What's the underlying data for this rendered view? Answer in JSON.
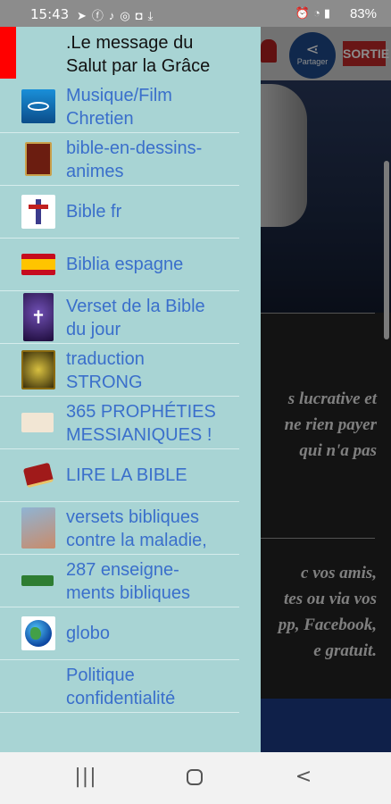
{
  "status_bar": {
    "time": "15:43",
    "left_icons": [
      "telegram-icon",
      "facebook-icon",
      "bell-icon",
      "notification-icon",
      "instagram-icon",
      "download-icon"
    ],
    "right_icons": [
      "alarm-icon",
      "wifi-icon",
      "signal-icon"
    ],
    "battery": "83%"
  },
  "drawer": {
    "header_title_line1": ".Le message du",
    "header_title_line2": "Salut par la Grâce",
    "accent_color": "#ff0000",
    "background": "#a8d4d4",
    "link_color": "#3a6fcb",
    "items": [
      {
        "line1": "Musique/Film",
        "line2": "Chretien",
        "icon": "fish-icon"
      },
      {
        "line1": "bible-en-dessins-",
        "line2": "animes",
        "icon": "book-icon"
      },
      {
        "line1": "Bible fr",
        "line2": "",
        "icon": "cross-icon"
      },
      {
        "line1": "Biblia espagne",
        "line2": "",
        "icon": "spain-flag-icon"
      },
      {
        "line1": "Verset de la Bible",
        "line2": "du jour",
        "icon": "verse-icon"
      },
      {
        "line1": "traduction",
        "line2": "STRONG",
        "icon": "strong-icon"
      },
      {
        "line1": "365 PROPHÉTIES",
        "line2": "MESSIANIQUES !",
        "icon": "prophecy-icon"
      },
      {
        "line1": "LIRE LA BIBLE",
        "line2": "",
        "icon": "bible-icon"
      },
      {
        "line1": " versets bibliques",
        "line2": "contre la maladie,",
        "icon": "hand-icon"
      },
      {
        "line1": "287 enseigne-",
        "line2": "ments bibliques",
        "icon": "teaching-icon"
      },
      {
        "line1": "globo",
        "line2": "",
        "icon": "globe-icon"
      },
      {
        "line1": "Politique",
        "line2": "confidentialité",
        "icon": ""
      }
    ]
  },
  "background_app": {
    "share_label": "Partager",
    "exit_label": "SORTIE",
    "text_lines_1": [
      "s lucrative et",
      "ne rien payer",
      "qui n'a pas"
    ],
    "text_lines_2": [
      "c  vos  amis,",
      "tes ou via vos",
      "pp,  Facebook,",
      "e gratuit."
    ]
  },
  "nav_bar": {
    "recent": "|||",
    "back": "<"
  }
}
